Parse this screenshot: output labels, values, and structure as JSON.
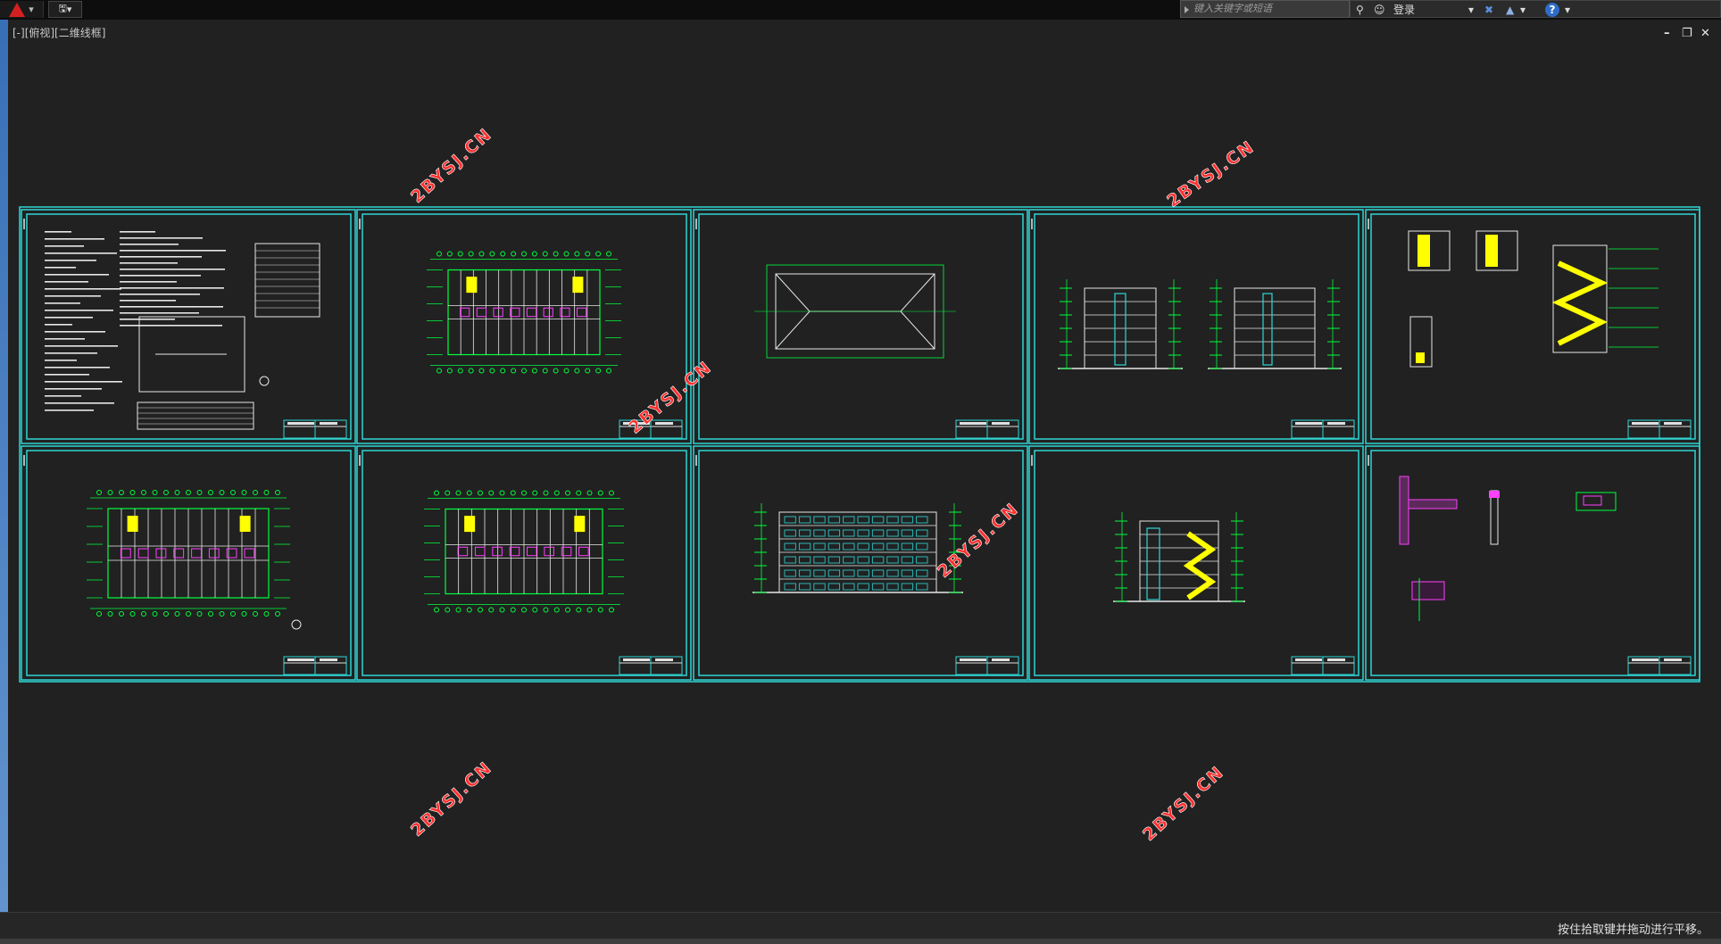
{
  "header": {
    "search_placeholder": "键入关键字或短语",
    "login_label": "登录",
    "help_label": "?"
  },
  "viewport": {
    "label": "[-][俯视][二维线框]"
  },
  "window_controls": {
    "minimize": "–",
    "restore": "❐",
    "close": "✕"
  },
  "watermark": "2BYSJ.CN",
  "status": {
    "message": "按住拾取键并拖动进行平移。"
  },
  "colors": {
    "background": "#212121",
    "frame": "#2fd6d6",
    "line": "#00ff3c",
    "accent_yellow": "#ffff00",
    "accent_magenta": "#ff40ff",
    "watermark": "#ff3030"
  },
  "sheets": [
    {
      "name": "design-notes"
    },
    {
      "name": "floor-plan-1"
    },
    {
      "name": "roof-plan"
    },
    {
      "name": "side-elevations"
    },
    {
      "name": "stair-details"
    },
    {
      "name": "ground-floor-plan"
    },
    {
      "name": "standard-floor-plan"
    },
    {
      "name": "front-elevation"
    },
    {
      "name": "section"
    },
    {
      "name": "wall-details"
    }
  ]
}
